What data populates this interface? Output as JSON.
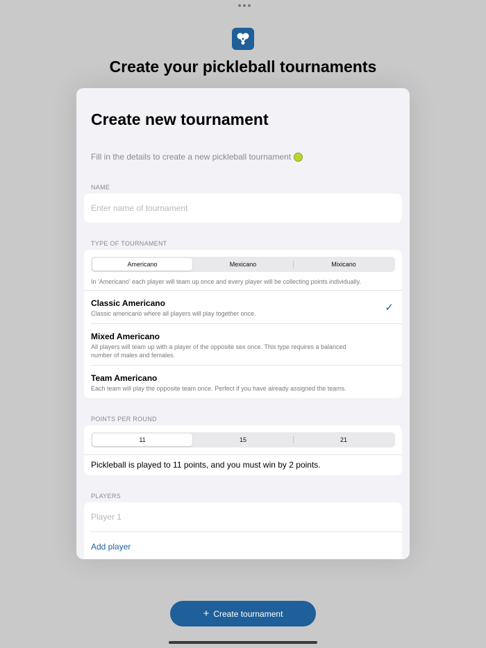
{
  "background": {
    "title": "Create your pickleball tournaments"
  },
  "sheet": {
    "title": "Create new tournament",
    "subtitle": "Fill in the details to create a new pickleball tournament"
  },
  "name_section": {
    "label": "NAME",
    "placeholder": "Enter name of tournament",
    "value": ""
  },
  "type_section": {
    "label": "TYPE OF TOURNAMENT",
    "segments": [
      "Americano",
      "Mexicano",
      "Mixicano"
    ],
    "selected_segment": "Americano",
    "hint": "In 'Americano' each player will team up once and every player will be collecting points individually.",
    "options": [
      {
        "title": "Classic Americano",
        "description": "Classic americano where all players will play together once.",
        "selected": true
      },
      {
        "title": "Mixed Americano",
        "description": "All players will team up with a player of the opposite sex once. This type requires a balanced number of males and females.",
        "selected": false
      },
      {
        "title": "Team Americano",
        "description": "Each team will play the opposite team once. Perfect if you have already assigned the teams.",
        "selected": false
      }
    ]
  },
  "points_section": {
    "label": "POINTS PER ROUND",
    "segments": [
      "11",
      "15",
      "21"
    ],
    "selected_segment": "11",
    "info": "Pickleball is played to 11 points, and you must win by 2 points."
  },
  "players_section": {
    "label": "PLAYERS",
    "player_placeholder": "Player 1",
    "add_label": "Add player"
  },
  "create_button": {
    "label": "Create tournament",
    "icon": "plus-icon"
  },
  "colors": {
    "accent": "#1f5f9a",
    "sheet_background": "#f2f2f7",
    "backdrop": "#c9c9c9"
  }
}
